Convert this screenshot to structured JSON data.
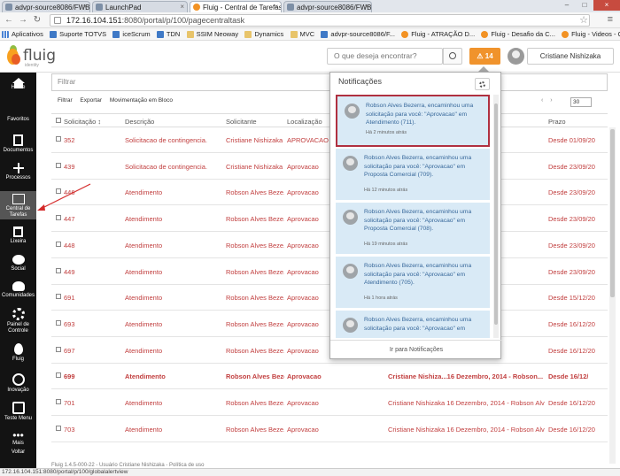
{
  "browser": {
    "tabs": [
      {
        "title": "advpr-source8086/FWBrow"
      },
      {
        "title": "LaunchPad"
      },
      {
        "title": "Fluig - Central de Tarefas"
      },
      {
        "title": "advpr-source8086/FWBr"
      }
    ],
    "url_host": "172.16.104.151",
    "url_path": ":8080/portal/p/100/pagecentraltask",
    "bookmarks": [
      "Aplicativos",
      "Suporte TOTVS",
      "iceScrum",
      "TDN",
      "SSIM Neoway",
      "Dynamics",
      "MVC",
      "advpr-source8086/F...",
      "Fluig - ATRAÇÃO D...",
      "Fluig - Desafio da C...",
      "Fluig - Videos - Gest..."
    ],
    "status_url": "172.16.104.151:8080/portal/p/100/globalalertview"
  },
  "header": {
    "logo_text": "fluig",
    "logo_sub": "identity",
    "search_placeholder": "O que deseja encontrar?",
    "alert_count": "14",
    "user_name": "Cristiane Nishizaka"
  },
  "sidebar": {
    "items": [
      {
        "label": "Home",
        "icon": "home-icon"
      },
      {
        "label": "Favoritos",
        "icon": "star-icon"
      },
      {
        "label": "Documentos",
        "icon": "documents-icon"
      },
      {
        "label": "Processos",
        "icon": "processes-icon"
      },
      {
        "label": "Central de Tarefas",
        "icon": "tasks-icon"
      },
      {
        "label": "Lixeira",
        "icon": "trash-icon"
      },
      {
        "label": "Social",
        "icon": "social-icon"
      },
      {
        "label": "Comunidades",
        "icon": "communities-icon"
      },
      {
        "label": "Painel de Controle",
        "icon": "control-panel-icon"
      },
      {
        "label": "Fluig",
        "icon": "fluig-icon"
      },
      {
        "label": "Inovação",
        "icon": "innovation-icon"
      },
      {
        "label": "Teste Menu",
        "icon": "test-menu-icon"
      },
      {
        "label": "Mais",
        "icon": "more-icon"
      },
      {
        "label": "Voltar",
        "icon": "back-icon"
      }
    ]
  },
  "main": {
    "filter_placeholder": "Filtrar",
    "actions": [
      "Filtrar",
      "Exportar",
      "Movimentação em Bloco"
    ],
    "page_size": "30",
    "columns": [
      "Solicitação",
      "Descrição",
      "Solicitante",
      "Localização",
      "Prazo"
    ],
    "rows": [
      {
        "id": "352",
        "desc": "Solicitacao de contingencia.",
        "requester": "Cristiane Nishizaka",
        "location": "APROVACAO",
        "resp": "- Cristiane Nis",
        "deadline": "Desde 01/09/20",
        "bold": false
      },
      {
        "id": "439",
        "desc": "Solicitacao de contingencia.",
        "requester": "Cristiane Nishizaka",
        "location": "Aprovacao",
        "resp": "4 - Cristiane N",
        "deadline": "Desde 23/09/20",
        "bold": false
      },
      {
        "id": "446",
        "desc": "Atendimento",
        "requester": "Robson Alves Beze...",
        "location": "Aprovacao",
        "resp": "4 - Robson Alv",
        "deadline": "Desde 23/09/20",
        "bold": false
      },
      {
        "id": "447",
        "desc": "Atendimento",
        "requester": "Robson Alves Beze...",
        "location": "Aprovacao",
        "resp": "4 - Robson Alv",
        "deadline": "Desde 23/09/20",
        "bold": false
      },
      {
        "id": "448",
        "desc": "Atendimento",
        "requester": "Robson Alves Beze...",
        "location": "Aprovacao",
        "resp": "4 - Robson Alv",
        "deadline": "Desde 23/09/20",
        "bold": false
      },
      {
        "id": "449",
        "desc": "Atendimento",
        "requester": "Robson Alves Beze...",
        "location": "Aprovacao",
        "resp": "4 - Robson Alv",
        "deadline": "Desde 23/09/20",
        "bold": false
      },
      {
        "id": "691",
        "desc": "Atendimento",
        "requester": "Robson Alves Beze...",
        "location": "Aprovacao",
        "resp": "- Robson Alve",
        "deadline": "Desde 15/12/20",
        "bold": false
      },
      {
        "id": "693",
        "desc": "Atendimento",
        "requester": "Robson Alves Beze...",
        "location": "Aprovacao",
        "resp": "- Robson Alve",
        "deadline": "Desde 16/12/20",
        "bold": false
      },
      {
        "id": "697",
        "desc": "Atendimento",
        "requester": "Robson Alves Beze...",
        "location": "Aprovacao",
        "resp": "- Robson Alve",
        "deadline": "Desde 16/12/20",
        "bold": false
      },
      {
        "id": "699",
        "desc": "Atendimento",
        "requester": "Robson Alves Beze...",
        "location": "Aprovacao",
        "resp": "Cristiane Nishiza...16 Dezembro, 2014 - Robson...",
        "deadline": "Desde 16/12/",
        "bold": true
      },
      {
        "id": "701",
        "desc": "Atendimento",
        "requester": "Robson Alves Beze...",
        "location": "Aprovacao",
        "resp": "Cristiane Nishizaka  16 Dezembro, 2014 - Robson Alv",
        "deadline": "Desde 16/12/20",
        "bold": false
      },
      {
        "id": "703",
        "desc": "Atendimento",
        "requester": "Robson Alves Beze...",
        "location": "Aprovacao",
        "resp": "Cristiane Nishizaka  16 Dezembro, 2014 - Robson Alv",
        "deadline": "Desde 16/12/20",
        "bold": false
      }
    ],
    "footer_text": "Fluig 1.4.5-000-22 - Usuário Cristiane Nishizaka - Política de uso"
  },
  "notifications": {
    "title": "Notificações",
    "items": [
      {
        "text": "Robson Alves Bezerra, encaminhou uma solicitação para você: \"Aprovacao\" em Atendimento (711).",
        "time": "Há 2 minutos atrás"
      },
      {
        "text": "Robson Alves Bezerra, encaminhou uma solicitação para você: \"Aprovacao\" em Proposta Comercial (709).",
        "time": "Há 12 minutos atrás"
      },
      {
        "text": "Robson Alves Bezerra, encaminhou uma solicitação para você: \"Aprovacao\" em Proposta Comercial (708).",
        "time": "Há 19 minutos atrás"
      },
      {
        "text": "Robson Alves Bezerra, encaminhou uma solicitação para você: \"Aprovacao\" em Atendimento (705).",
        "time": "Há 1 hora atrás"
      },
      {
        "text": "Robson Alves Bezerra, encaminhou uma solicitação para você: \"Aprovacao\" em",
        "time": ""
      }
    ],
    "footer_link": "Ir para Notificações"
  },
  "colors": {
    "accent": "#f0932c",
    "link": "#c13e3e",
    "sidebar_bg": "#131313",
    "notif_bg": "#d9eaf6",
    "highlight": "#b03040"
  }
}
